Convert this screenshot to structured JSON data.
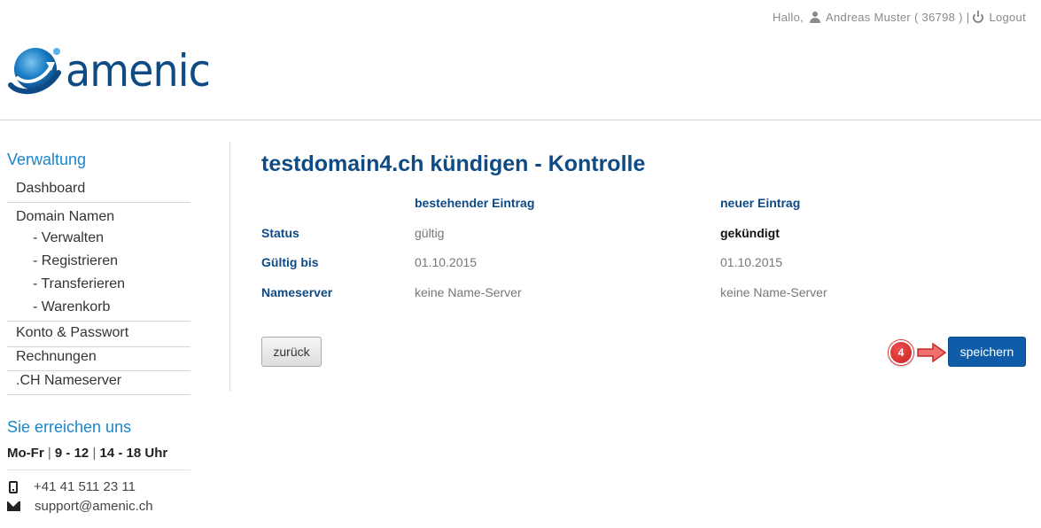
{
  "header": {
    "greeting": "Hallo,",
    "user_name": "Andreas Muster",
    "user_id": "( 36798 )",
    "separator": "|",
    "logout_label": "Logout",
    "logo_text": "amenic"
  },
  "sidebar": {
    "admin_title": "Verwaltung",
    "nav": [
      {
        "label": "Dashboard"
      },
      {
        "label": "Domain Namen"
      },
      {
        "label": "- Verwalten"
      },
      {
        "label": "- Registrieren"
      },
      {
        "label": "- Transferieren"
      },
      {
        "label": "- Warenkorb"
      },
      {
        "label": "Konto & Passwort"
      },
      {
        "label": "Rechnungen"
      },
      {
        "label": ".CH Nameserver"
      }
    ],
    "contact_title": "Sie erreichen uns",
    "hours": {
      "days": "Mo-Fr",
      "sep": "|",
      "morning": "9 - 12",
      "afternoon": "14 - 18 Uhr"
    },
    "phone": "+41 41 511 23 11",
    "email": "support@amenic.ch"
  },
  "main": {
    "title": "testdomain4.ch kündigen - Kontrolle",
    "columns": {
      "existing": "bestehender Eintrag",
      "new": "neuer Eintrag"
    },
    "rows": [
      {
        "label": "Status",
        "existing": "gültig",
        "new": "gekündigt"
      },
      {
        "label": "Gültig bis",
        "existing": "01.10.2015",
        "new": "01.10.2015"
      },
      {
        "label": "Nameserver",
        "existing": "keine Name-Server",
        "new": "keine Name-Server"
      }
    ],
    "back_label": "zurück",
    "save_label": "speichern",
    "step_number": "4"
  },
  "colors": {
    "brand": "#0e4a84",
    "accent": "#1a86c8",
    "primary_button": "#0f5da8",
    "badge": "#d32f2f"
  }
}
